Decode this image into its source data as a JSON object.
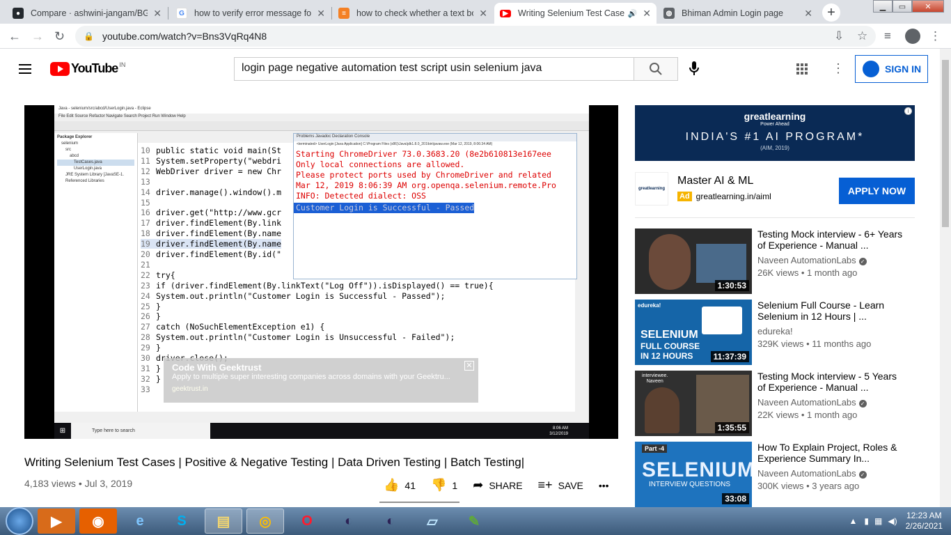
{
  "browser": {
    "tabs": [
      {
        "title": "Compare · ashwini-jangam/BG",
        "icon": "github-icon",
        "color": "#24292e"
      },
      {
        "title": "how to verify error message for",
        "icon": "google-icon",
        "color": "#4285f4"
      },
      {
        "title": "how to check whether a text bo",
        "icon": "stackoverflow-icon",
        "color": "#f48024"
      },
      {
        "title": "Writing Selenium Test Case",
        "icon": "youtube-icon",
        "color": "#ff0000",
        "active": true
      },
      {
        "title": "Bhiman Admin Login page",
        "icon": "globe-icon",
        "color": "#5f6368"
      }
    ],
    "url": "youtube.com/watch?v=Bns3VqRq4N8"
  },
  "youtube": {
    "logo": "YouTube",
    "country": "IN",
    "search_query": "login page negative  automation test script usin selenium java",
    "sign_in": "SIGN IN"
  },
  "video": {
    "title": "Writing Selenium Test Cases | Positive & Negative Testing | Data Driven Testing | Batch Testing|",
    "meta": "4,183 views • Jul 3, 2019",
    "likes": "41",
    "dislikes": "1",
    "share": "SHARE",
    "save": "SAVE",
    "frame": {
      "window_title": "Java - selenium/src/abcd/UserLogin.java - Eclipse",
      "menu": "File  Edit  Source  Refactor  Navigate  Search  Project  Run  Window  Help",
      "explorer": [
        "Package Explorer",
        "selenium",
        "src",
        "abcd",
        "TestCases.java",
        "UserLogin.java",
        "JRE System Library [JavaSE-1.",
        "Referenced Libraries"
      ],
      "code": [
        {
          "n": "10",
          "t": "public static void main(St"
        },
        {
          "n": "11",
          "t": "System.setProperty(\"webdri"
        },
        {
          "n": "12",
          "t": "WebDriver driver = new Chr"
        },
        {
          "n": "13",
          "t": ""
        },
        {
          "n": "14",
          "t": "driver.manage().window().m"
        },
        {
          "n": "15",
          "t": ""
        },
        {
          "n": "16",
          "t": "driver.get(\"http://www.gcr"
        },
        {
          "n": "17",
          "t": "driver.findElement(By.link"
        },
        {
          "n": "18",
          "t": "driver.findElement(By.name"
        },
        {
          "n": "19",
          "t": "driver.findElement(By.name"
        },
        {
          "n": "20",
          "t": "driver.findElement(By.id(\""
        },
        {
          "n": "21",
          "t": ""
        },
        {
          "n": "22",
          "t": "try{"
        },
        {
          "n": "23",
          "t": "if (driver.findElement(By.linkText(\"Log Off\")).isDisplayed() == true){"
        },
        {
          "n": "24",
          "t": "System.out.println(\"Customer Login is Successful - Passed\");"
        },
        {
          "n": "25",
          "t": "}"
        },
        {
          "n": "26",
          "t": "}"
        },
        {
          "n": "27",
          "t": "catch (NoSuchElementException e1) {"
        },
        {
          "n": "28",
          "t": "System.out.println(\"Customer Login is Unsuccessful - Failed\");"
        },
        {
          "n": "29",
          "t": "}"
        },
        {
          "n": "30",
          "t": "driver.close();"
        },
        {
          "n": "31",
          "t": "}"
        },
        {
          "n": "32",
          "t": "}"
        },
        {
          "n": "33",
          "t": ""
        }
      ],
      "console_tabs": "Problems  Javadoc  Declaration  Console",
      "console_header": "<terminated> UserLogin [Java Application] C:\\Program Files (x86)\\Java\\jdk1.8.0_201\\bin\\javaw.exe (Mar 12, 2019, 8:06:34 AM)",
      "console": [
        "Starting ChromeDriver 73.0.3683.20 (8e2b610813e167eee",
        "Only local connections are allowed.",
        "Please protect ports used by ChromeDriver and related",
        "Mar 12, 2019 8:06:39 AM org.openqa.selenium.remote.Pro",
        "INFO: Detected dialect: OSS",
        "Customer Login is Successful - Passed"
      ],
      "overlay_ad": {
        "title": "Code With Geektrust",
        "text": "Apply to multiple super interesting companies across domains with your Geektru...",
        "url": "geektrust.in"
      },
      "taskbar_search": "Type here to search",
      "clock_time": "8:06 AM",
      "clock_date": "3/12/2019"
    }
  },
  "ad": {
    "brand": "greatlearning",
    "brand_tag": "Power Ahead",
    "headline": "INDIA'S #1 AI PROGRAM*",
    "sub": "(AIM, 2019)",
    "card_logo": "greatlearning",
    "name": "Master AI & ML",
    "badge": "Ad",
    "url": "greatlearning.in/aiml",
    "cta": "APPLY NOW"
  },
  "recommendations": [
    {
      "title": "Testing Mock interview - 6+ Years of Experience - Manual ...",
      "channel": "Naveen AutomationLabs",
      "views": "26K views • 1 month ago",
      "duration": "1:30:53",
      "thumb_color": "#2b2b2b"
    },
    {
      "title": "Selenium Full Course - Learn Selenium in 12 Hours | ...",
      "channel": "edureka!",
      "views": "329K views • 11 months ago",
      "duration": "11:37:39",
      "thumb_color": "#1565a8",
      "thumb_text": [
        "edureka!",
        "SELENIUM",
        "FULL COURSE",
        "IN 12 HOURS"
      ]
    },
    {
      "title": "Testing Mock interview - 5 Years of Experience - Manual ...",
      "channel": "Naveen AutomationLabs",
      "views": "22K views • 1 month ago",
      "duration": "1:35:55",
      "thumb_color": "#303030",
      "thumb_text": [
        "interviewee.",
        "Naveen"
      ]
    },
    {
      "title": "How To Explain Project, Roles & Experience Summary In...",
      "channel": "Naveen AutomationLabs",
      "views": "300K views • 3 years ago",
      "duration": "33:08",
      "thumb_color": "#1e73be",
      "thumb_text": [
        "Part -4",
        "SELENIUM",
        "INTERVIEW QUESTIONS"
      ]
    }
  ],
  "system": {
    "time": "12:23 AM",
    "date": "2/26/2021"
  }
}
